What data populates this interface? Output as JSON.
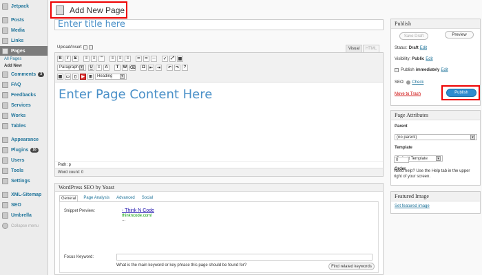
{
  "sidebar": {
    "items": [
      {
        "label": "Jetpack",
        "icon": "jetpack-icon"
      },
      {
        "label": "Posts",
        "icon": "posts-icon"
      },
      {
        "label": "Media",
        "icon": "media-icon"
      },
      {
        "label": "Links",
        "icon": "links-icon"
      },
      {
        "label": "Pages",
        "icon": "pages-icon"
      },
      {
        "label": "All Pages"
      },
      {
        "label": "Add New"
      },
      {
        "label": "Comments",
        "icon": "comments-icon",
        "badge": "3"
      },
      {
        "label": "FAQ",
        "icon": "faq-icon"
      },
      {
        "label": "Feedbacks",
        "icon": "feedbacks-icon"
      },
      {
        "label": "Services",
        "icon": "services-icon"
      },
      {
        "label": "Works",
        "icon": "works-icon"
      },
      {
        "label": "Tables",
        "icon": "tables-icon"
      },
      {
        "label": "Appearance",
        "icon": "appearance-icon"
      },
      {
        "label": "Plugins",
        "icon": "plugins-icon",
        "badge": "16"
      },
      {
        "label": "Users",
        "icon": "users-icon"
      },
      {
        "label": "Tools",
        "icon": "tools-icon"
      },
      {
        "label": "Settings",
        "icon": "settings-icon"
      },
      {
        "label": "XML-Sitemap",
        "icon": "sitemap-icon"
      },
      {
        "label": "SEO",
        "icon": "seo-icon"
      },
      {
        "label": "Umbrella",
        "icon": "umbrella-icon"
      },
      {
        "label": "Collapse menu",
        "icon": "collapse-icon"
      }
    ]
  },
  "header": {
    "page_title": "Add New Page"
  },
  "editor": {
    "title_placeholder": "Enter title here",
    "upload_label": "Upload/Insert",
    "tab_visual": "Visual",
    "tab_html": "HTML",
    "format_select": "Paragraph",
    "heading_select": "Heading",
    "content": "Enter Page Content Here",
    "path": "Path: p",
    "word_count": "Word count: 0"
  },
  "seo": {
    "title": "WordPress SEO by Yoast",
    "tabs": [
      "General",
      "Page Analysis",
      "Advanced",
      "Social"
    ],
    "snippet_label": "Snippet Preview:",
    "snippet_title": "- Think N Code",
    "snippet_url": "thinkncode.com/",
    "snippet_dots": "...",
    "focus_label": "Focus Keyword:",
    "help": "What is the main keyword or key phrase this page should be found for?",
    "find_button": "Find related keywords"
  },
  "publish": {
    "title": "Publish",
    "save_draft": "Save Draft",
    "preview": "Preview",
    "status_label": "Status:",
    "status_value": "Draft",
    "visibility_label": "Visibility:",
    "visibility_value": "Public",
    "publish_label": "Publish",
    "publish_value": "immediately",
    "edit": "Edit",
    "seo_label": "SEO:",
    "seo_check": "Check",
    "trash": "Move to Trash",
    "publish_button": "Publish"
  },
  "attributes": {
    "title": "Page Attributes",
    "parent_label": "Parent",
    "parent_value": "(no parent)",
    "template_label": "Template",
    "template_value": "Default Template",
    "order_label": "Order",
    "order_value": "0",
    "help": "Need help? Use the Help tab in the upper right of your screen."
  },
  "featured": {
    "title": "Featured Image",
    "link": "Set featured image"
  },
  "colors": {
    "accent": "#21759b",
    "publish": "#2e8ccf",
    "highlight": "#e00000"
  }
}
